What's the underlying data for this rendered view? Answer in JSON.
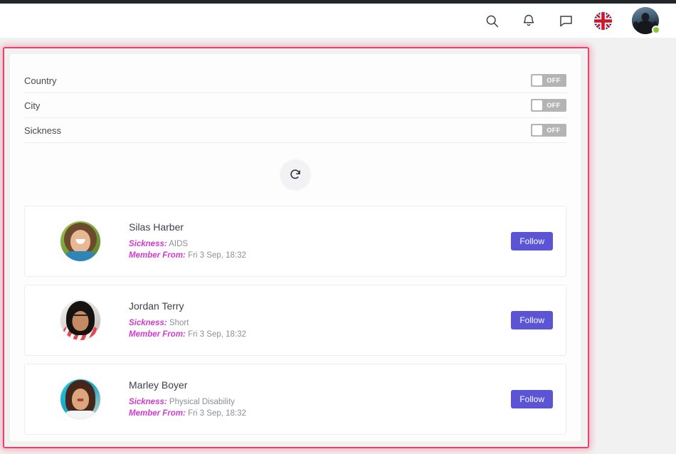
{
  "header": {
    "icons": [
      {
        "name": "search-icon",
        "label": "Search"
      },
      {
        "name": "bell-icon",
        "label": "Notifications"
      },
      {
        "name": "chat-icon",
        "label": "Messages"
      },
      {
        "name": "uk-flag-icon",
        "label": "English (UK)"
      }
    ],
    "avatar_name": "user-avatar",
    "status": "online",
    "status_color": "#8cc63f"
  },
  "filters": {
    "rows": [
      {
        "label": "Country",
        "state": "OFF",
        "on": false
      },
      {
        "label": "City",
        "state": "OFF",
        "on": false
      },
      {
        "label": "Sickness",
        "state": "OFF",
        "on": false
      }
    ]
  },
  "refresh": {
    "icon": "refresh-icon",
    "label": "Refresh"
  },
  "users": [
    {
      "name": "Silas Harber",
      "sickness_label": "Sickness:",
      "sickness_value": "AIDS",
      "member_label": "Member From:",
      "member_value": "Fri 3 Sep, 18:32",
      "action": "Follow"
    },
    {
      "name": "Jordan Terry",
      "sickness_label": "Sickness:",
      "sickness_value": "Short",
      "member_label": "Member From:",
      "member_value": "Fri 3 Sep, 18:32",
      "action": "Follow"
    },
    {
      "name": "Marley Boyer",
      "sickness_label": "Sickness:",
      "sickness_value": "Physical Disability",
      "member_label": "Member From:",
      "member_value": "Fri 3 Sep, 18:32",
      "action": "Follow"
    }
  ],
  "colors": {
    "accent_button": "#5b55d6",
    "meta_key": "#d13ad1",
    "highlight_border": "#e8416a",
    "toggle_off": "#b4b4b4",
    "page_bg": "#f2f1f2"
  }
}
